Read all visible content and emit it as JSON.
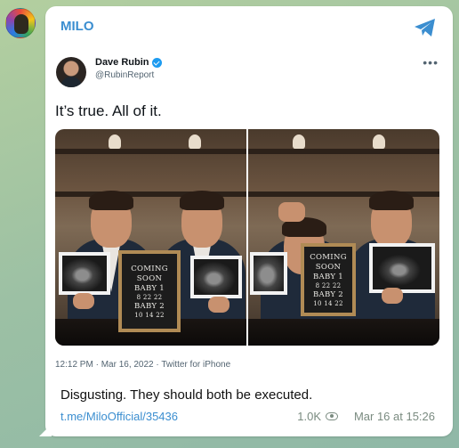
{
  "channel": {
    "name": "MILO"
  },
  "tweet": {
    "author_name": "Dave Rubin",
    "author_handle": "@RubinReport",
    "text": "It’s true. All of it.",
    "meta": "12:12 PM · Mar 16, 2022 · Twitter for iPhone",
    "photo_left_board": [
      "COMING",
      "SOON",
      "BABY 1",
      "8 22 22",
      "BABY 2",
      "10 14 22"
    ],
    "photo_right_board": [
      "COMING",
      "SOON",
      "BABY 1",
      "8 22 22",
      "BABY 2",
      "10 14 22"
    ]
  },
  "message": {
    "text": "Disgusting. They should both be executed.",
    "link": "t.me/MiloOfficial/35436",
    "views": "1.0K",
    "timestamp": "Mar 16 at 15:26"
  },
  "icons": {
    "channel_avatar": "channel-avatar",
    "share": "telegram-share-icon",
    "verified": "verified-badge-icon",
    "more": "more-options-icon",
    "views": "eye-icon"
  },
  "colors": {
    "accent": "#3b8ed0",
    "verified": "#1d9bf0",
    "muted": "#7a8b80"
  }
}
